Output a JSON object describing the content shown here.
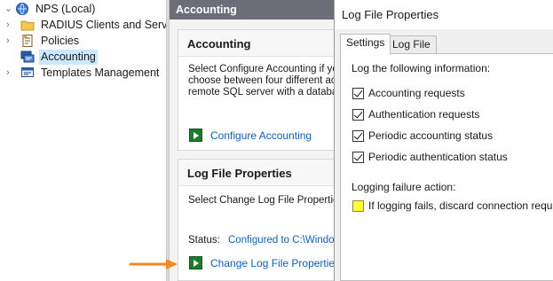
{
  "tree": {
    "items": [
      {
        "label": "NPS (Local)",
        "icon": "nps-server-icon",
        "expander": "⌄",
        "selected": false
      },
      {
        "label": "RADIUS Clients and Servers",
        "icon": "folder-icon",
        "expander": "›",
        "selected": false
      },
      {
        "label": "Policies",
        "icon": "policies-icon",
        "expander": "›",
        "selected": false
      },
      {
        "label": "Accounting",
        "icon": "accounting-icon",
        "expander": "",
        "selected": true
      },
      {
        "label": "Templates Management",
        "icon": "templates-icon",
        "expander": "›",
        "selected": false
      }
    ]
  },
  "middle": {
    "header": "Accounting",
    "accounting_card": {
      "title": "Accounting",
      "lines": [
        "Select Configure Accounting if you",
        "choose between four different acc",
        "remote SQL server with a database"
      ],
      "link": "Configure Accounting"
    },
    "log_card": {
      "title": "Log File Properties",
      "description": "Select Change Log File Properties",
      "status_label": "Status:",
      "status_value": "Configured to C:\\Window",
      "link": "Change Log File Properties"
    }
  },
  "dialog": {
    "title": "Log File Properties",
    "tabs": [
      {
        "label": "Settings",
        "active": true
      },
      {
        "label": "Log File",
        "active": false
      }
    ],
    "info_label": "Log the following information:",
    "checkboxes": [
      {
        "label": "Accounting requests",
        "checked": true
      },
      {
        "label": "Authentication requests",
        "checked": true
      },
      {
        "label": "Periodic accounting status",
        "checked": true
      },
      {
        "label": "Periodic authentication status",
        "checked": true
      }
    ],
    "failure_label": "Logging failure action:",
    "failure_checkbox": {
      "label": "If logging fails, discard connection requests.",
      "checked": false,
      "highlight_color": "#ffff3a"
    }
  },
  "colors": {
    "header_bg": "#6b6e76",
    "link": "#0f5fb6",
    "selection": "#cce8ff",
    "arrow": "#f08a24",
    "go_icon": "#1e7a2c"
  }
}
